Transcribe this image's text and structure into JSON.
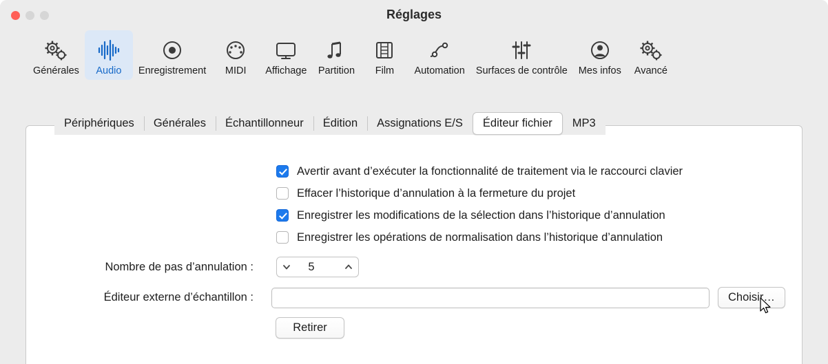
{
  "window": {
    "title": "Réglages",
    "traffic_lights": [
      "close",
      "minimize",
      "zoom"
    ]
  },
  "toolbar": {
    "items": [
      {
        "label": "Générales",
        "icon": "gears-icon",
        "selected": false
      },
      {
        "label": "Audio",
        "icon": "waveform-icon",
        "selected": true
      },
      {
        "label": "Enregistrement",
        "icon": "record-circle-icon",
        "selected": false
      },
      {
        "label": "MIDI",
        "icon": "midi-dial-icon",
        "selected": false
      },
      {
        "label": "Affichage",
        "icon": "display-monitor-icon",
        "selected": false
      },
      {
        "label": "Partition",
        "icon": "music-notes-icon",
        "selected": false
      },
      {
        "label": "Film",
        "icon": "film-strip-icon",
        "selected": false
      },
      {
        "label": "Automation",
        "icon": "automation-curve-icon",
        "selected": false
      },
      {
        "label": "Surfaces de contrôle",
        "icon": "sliders-icon",
        "selected": false
      },
      {
        "label": "Mes infos",
        "icon": "person-circle-icon",
        "selected": false
      },
      {
        "label": "Avancé",
        "icon": "gears-advanced-icon",
        "selected": false
      }
    ]
  },
  "tabs": [
    {
      "label": "Périphériques",
      "active": false
    },
    {
      "label": "Générales",
      "active": false
    },
    {
      "label": "Échantillonneur",
      "active": false
    },
    {
      "label": "Édition",
      "active": false
    },
    {
      "label": "Assignations E/S",
      "active": false
    },
    {
      "label": "Éditeur fichier",
      "active": true
    },
    {
      "label": "MP3",
      "active": false
    }
  ],
  "checkboxes": [
    {
      "label": "Avertir avant d’exécuter la fonctionnalité de traitement via le raccourci clavier",
      "checked": true
    },
    {
      "label": "Effacer l’historique d’annulation à la fermeture du projet",
      "checked": false
    },
    {
      "label": "Enregistrer les modifications de la sélection dans l’historique d’annulation",
      "checked": true
    },
    {
      "label": "Enregistrer les opérations de normalisation dans l’historique d’annulation",
      "checked": false
    }
  ],
  "undo_steps": {
    "label": "Nombre de pas d’annulation :",
    "value": "5"
  },
  "external_editor": {
    "label": "Éditeur externe d’échantillon :",
    "value": "",
    "placeholder": "",
    "choose_button": "Choisir…",
    "remove_button": "Retirer"
  },
  "colors": {
    "accent_blue": "#1c7aed",
    "selected_tab_bg": "#dce8f7",
    "selected_tab_text": "#1669c8",
    "window_bg": "#ececec",
    "pane_bg": "#ffffff",
    "close_red": "#ff5f57"
  }
}
